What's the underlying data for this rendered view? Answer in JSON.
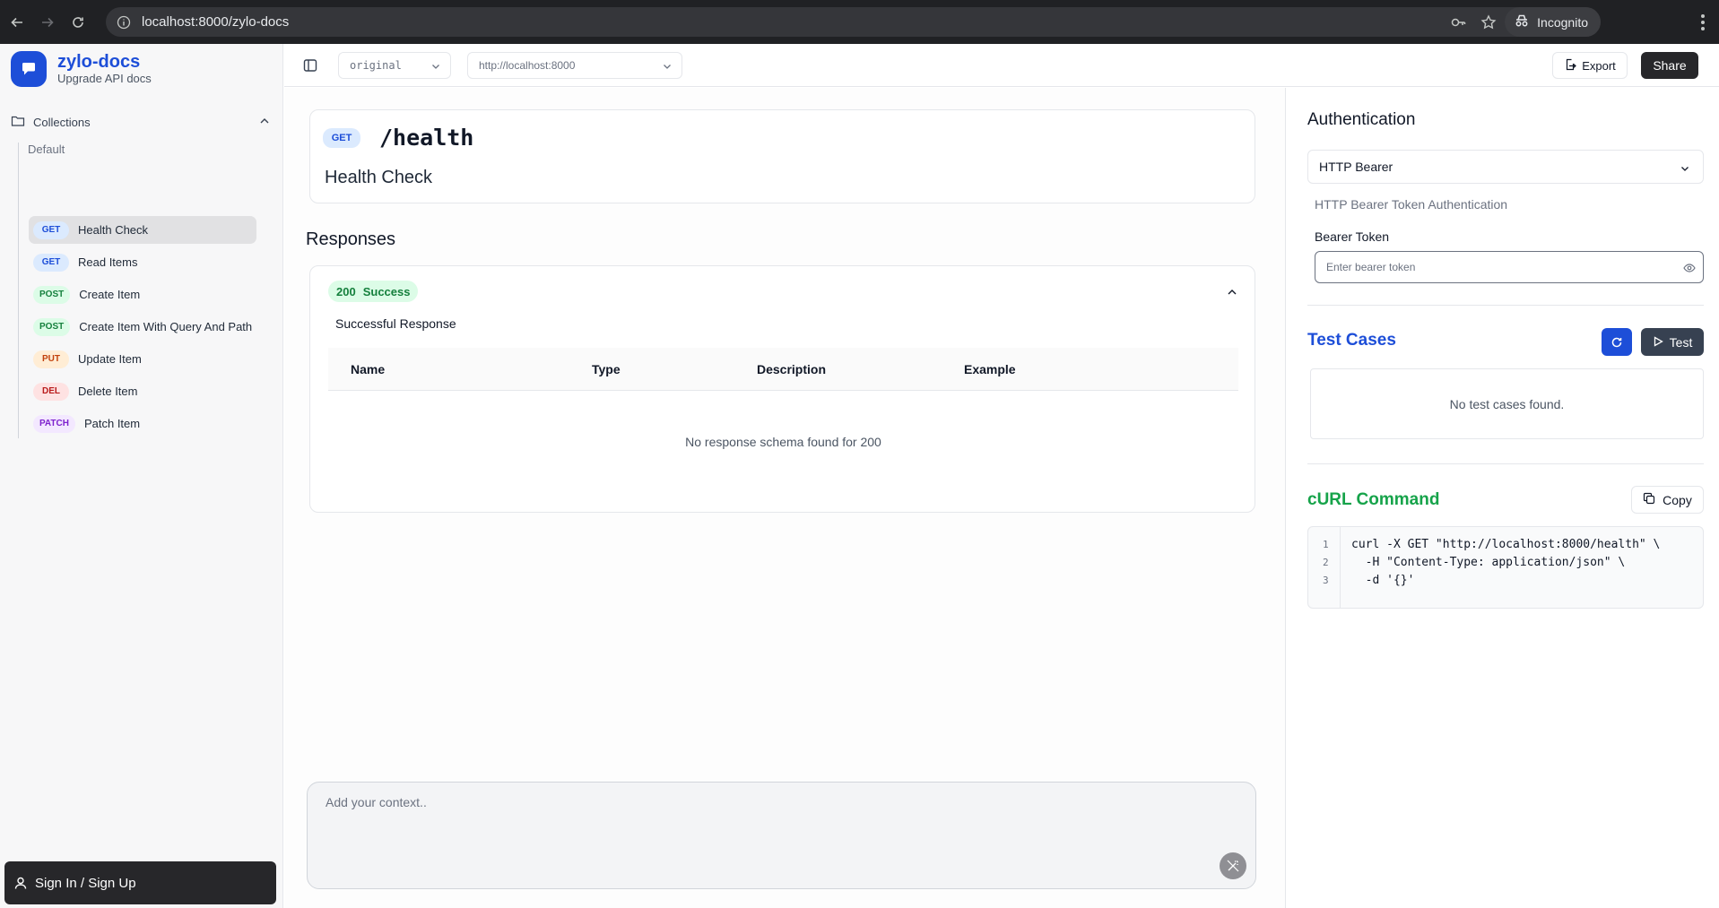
{
  "browser": {
    "url": "localhost:8000/zylo-docs",
    "profile_label": "Incognito"
  },
  "sidebar": {
    "brand_title": "zylo-docs",
    "brand_subtitle": "Upgrade API docs",
    "collections_label": "Collections",
    "group_label": "Default",
    "endpoints": [
      {
        "method": "GET",
        "label": "Health Check",
        "active": true
      },
      {
        "method": "GET",
        "label": "Read Items"
      },
      {
        "method": "POST",
        "label": "Create Item"
      },
      {
        "method": "POST",
        "label": "Create Item With Query And Path"
      },
      {
        "method": "PUT",
        "label": "Update Item"
      },
      {
        "method": "DEL",
        "label": "Delete Item"
      },
      {
        "method": "PATCH",
        "label": "Patch Item"
      }
    ],
    "signin_label": "Sign In / Sign Up"
  },
  "toolbar": {
    "version_select": "original",
    "server_select": "http://localhost:8000",
    "export_label": "Export",
    "share_label": "Share"
  },
  "endpoint": {
    "method": "GET",
    "path": "/health",
    "title": "Health Check"
  },
  "responses": {
    "heading": "Responses",
    "status_code": "200",
    "status_text": "Success",
    "description": "Successful Response",
    "columns": [
      "Name",
      "Type",
      "Description",
      "Example"
    ],
    "empty_message": "No response schema found for 200"
  },
  "context": {
    "placeholder": "Add your context.."
  },
  "auth": {
    "title": "Authentication",
    "type": "HTTP Bearer",
    "description": "HTTP Bearer Token Authentication",
    "token_label": "Bearer Token",
    "token_placeholder": "Enter bearer token"
  },
  "test_cases": {
    "title": "Test Cases",
    "test_button": "Test",
    "empty_message": "No test cases found."
  },
  "curl": {
    "title": "cURL Command",
    "copy_label": "Copy",
    "lines": [
      "curl -X GET \"http://localhost:8000/health\" \\",
      "  -H \"Content-Type: application/json\" \\",
      "  -d '{}'"
    ],
    "line_numbers": [
      "1",
      "2",
      "3"
    ]
  },
  "colors": {
    "brand": "#1d4ed8",
    "get": "#1d4ed8",
    "post": "#15803d",
    "put": "#c2410c",
    "delete": "#b91c1c",
    "patch": "#7e22ce",
    "curl_title": "#16a34a"
  },
  "icons": [
    "back-arrow-icon",
    "forward-arrow-icon",
    "reload-icon",
    "site-info-icon",
    "key-icon",
    "star-icon",
    "incognito-icon",
    "menu-icon",
    "logo-icon",
    "folder-icon",
    "chevron-up-icon",
    "chevron-down-icon",
    "user-icon",
    "sidebar-toggle-icon",
    "export-icon",
    "magic-wand-icon",
    "eye-icon",
    "refresh-icon",
    "play-icon",
    "copy-icon"
  ]
}
